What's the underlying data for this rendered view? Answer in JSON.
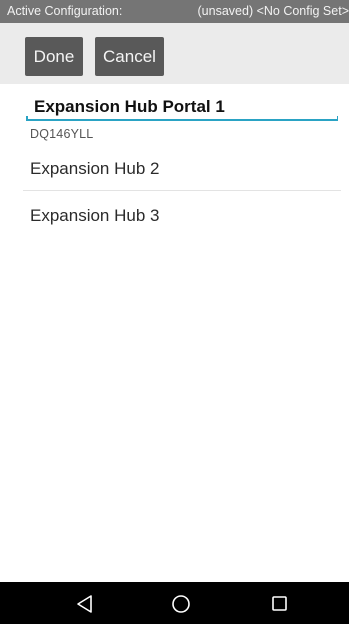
{
  "status_bar": {
    "label": "Active Configuration:",
    "value": "(unsaved) <No Config Set>"
  },
  "toolbar": {
    "done_label": "Done",
    "cancel_label": "Cancel"
  },
  "portal": {
    "name": "Expansion Hub Portal 1",
    "serial": "DQ146YLL"
  },
  "hubs": [
    {
      "label": "Expansion Hub 2"
    },
    {
      "label": "Expansion Hub 3"
    }
  ],
  "nav": {
    "back_icon": "back-triangle-icon",
    "home_icon": "home-circle-icon",
    "recents_icon": "recents-square-icon"
  },
  "colors": {
    "status_bar_bg": "#757575",
    "toolbar_bg": "#ebebeb",
    "button_bg": "#595959",
    "accent": "#2aa3c4"
  }
}
